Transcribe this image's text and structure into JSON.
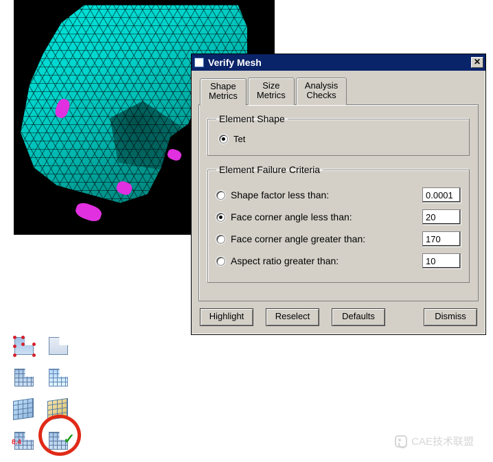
{
  "dialog": {
    "title": "Verify Mesh",
    "tabs": [
      {
        "line1": "Shape",
        "line2": "Metrics"
      },
      {
        "line1": "Size",
        "line2": "Metrics"
      },
      {
        "line1": "Analysis",
        "line2": "Checks"
      }
    ],
    "element_shape": {
      "legend": "Element Shape",
      "option": "Tet"
    },
    "criteria": {
      "legend": "Element Failure Criteria",
      "rows": [
        {
          "label": "Shape factor less than:",
          "value": "0.0001"
        },
        {
          "label": "Face corner angle less than:",
          "value": "20"
        },
        {
          "label": "Face corner angle greater than:",
          "value": "170"
        },
        {
          "label": "Aspect ratio greater than:",
          "value": "10"
        }
      ]
    },
    "buttons": {
      "highlight": "Highlight",
      "reselect": "Reselect",
      "defaults": "Defaults",
      "dismiss": "Dismiss"
    }
  },
  "watermark": "CAE技术联盟"
}
